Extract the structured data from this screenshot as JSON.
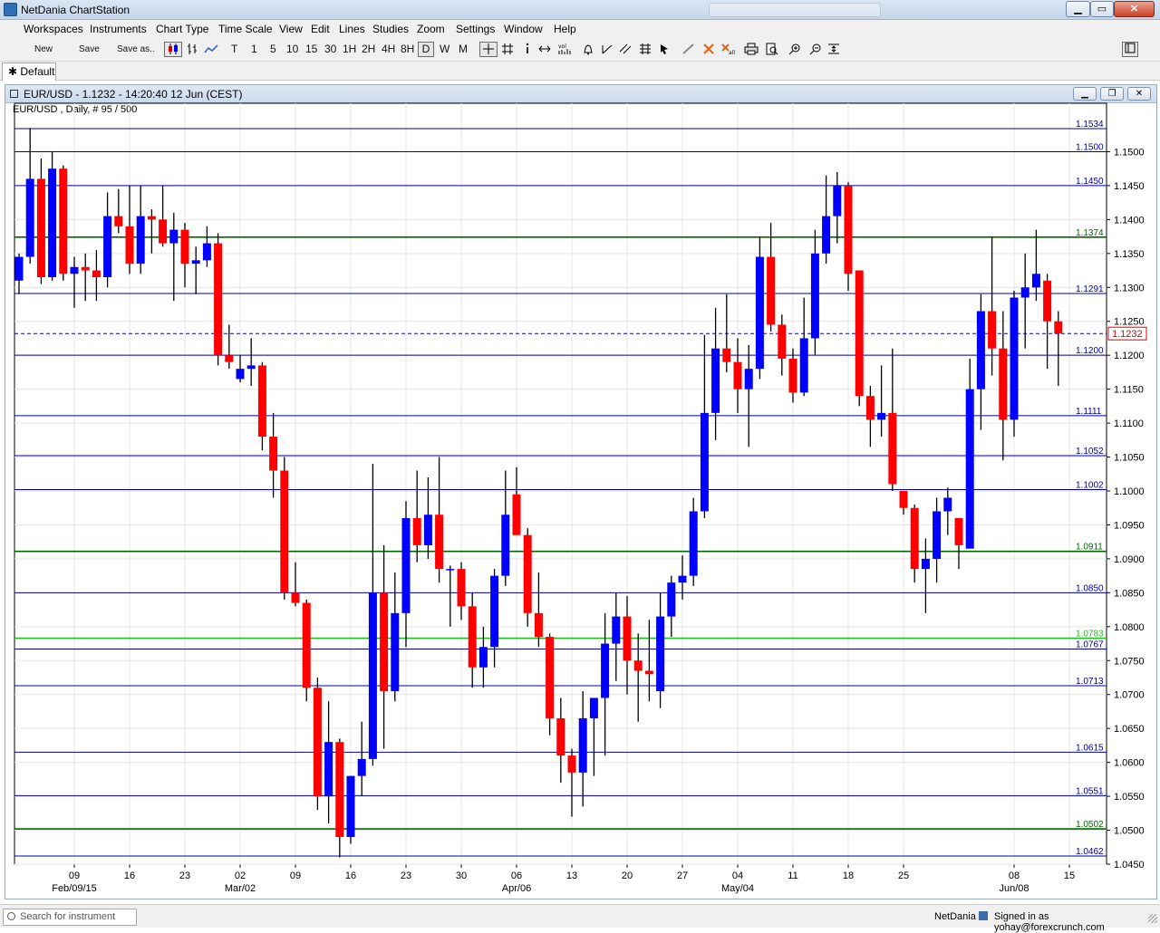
{
  "app": {
    "title": "NetDania ChartStation",
    "window_buttons": {
      "minimize": "▁",
      "maximize": "▭",
      "close": "✕"
    }
  },
  "menu": [
    "Workspaces",
    "Instruments",
    "Chart Type",
    "Time Scale",
    "View",
    "Edit",
    "Lines",
    "Studies",
    "Zoom",
    "Settings",
    "Window",
    "Help"
  ],
  "toolbar": {
    "new_label": "New",
    "save_label": "Save",
    "save_as_label": "Save as..",
    "timeframes": [
      "T",
      "1",
      "5",
      "10",
      "15",
      "30",
      "1H",
      "2H",
      "4H",
      "8H",
      "D",
      "W",
      "M"
    ],
    "selected_timeframe": "D",
    "icons": [
      "candlestick-icon",
      "ohlc-bars-icon",
      "line-chart-icon",
      "crosshair-icon",
      "grid-icon",
      "info-icon",
      "arrows-icon",
      "volume-icon",
      "bell-icon",
      "trendline-icon",
      "delete-icon",
      "print-icon",
      "zoom-in-icon",
      "zoom-out-icon",
      "fit-icon"
    ]
  },
  "tabs": {
    "active": "Default"
  },
  "chart_window": {
    "title": "EUR/USD - 1.1232 - 14:20:40  12 Jun (CEST)",
    "info": "EUR/USD , Daily, # 95 / 500"
  },
  "chart_data": {
    "type": "candlestick",
    "symbol": "EUR/USD",
    "timeframe": "Daily",
    "ylim": [
      1.045,
      1.155
    ],
    "yticks": [
      1.045,
      1.05,
      1.055,
      1.06,
      1.065,
      1.07,
      1.075,
      1.08,
      1.085,
      1.09,
      1.095,
      1.1,
      1.105,
      1.11,
      1.115,
      1.12,
      1.125,
      1.13,
      1.135,
      1.14,
      1.145,
      1.15
    ],
    "xticks": [
      {
        "label": "09",
        "sub": "Feb/09/15",
        "index": 5
      },
      {
        "label": "16",
        "index": 10
      },
      {
        "label": "23",
        "index": 15
      },
      {
        "label": "02",
        "sub": "Mar/02",
        "index": 20
      },
      {
        "label": "09",
        "index": 25
      },
      {
        "label": "16",
        "index": 30
      },
      {
        "label": "23",
        "index": 35
      },
      {
        "label": "30",
        "index": 40
      },
      {
        "label": "06",
        "sub": "Apr/06",
        "index": 45
      },
      {
        "label": "13",
        "index": 50
      },
      {
        "label": "20",
        "index": 55
      },
      {
        "label": "27",
        "index": 60
      },
      {
        "label": "04",
        "sub": "May/04",
        "index": 65
      },
      {
        "label": "11",
        "index": 70
      },
      {
        "label": "18",
        "index": 75
      },
      {
        "label": "25",
        "index": 80
      },
      {
        "label": "08",
        "sub": "Jun/08",
        "index": 90
      },
      {
        "label": "15",
        "index": 95
      }
    ],
    "current_price": "1.1232",
    "horizontal_lines": [
      {
        "value": 1.1534,
        "label": "1.1534",
        "color": "#0000aa"
      },
      {
        "value": 1.15,
        "label": "1.1500",
        "color": "#0000aa"
      },
      {
        "value": 1.145,
        "label": "1.1450",
        "color": "#0000aa"
      },
      {
        "value": 1.1374,
        "label": "1.1374",
        "color": "#006600"
      },
      {
        "value": 1.1291,
        "label": "1.1291",
        "color": "#0000aa"
      },
      {
        "value": 1.12,
        "label": "1.1200",
        "color": "#0000aa"
      },
      {
        "value": 1.1111,
        "label": "1.1111",
        "color": "#0000aa"
      },
      {
        "value": 1.1052,
        "label": "1.1052",
        "color": "#0000aa"
      },
      {
        "value": 1.1002,
        "label": "1.1002",
        "color": "#0000aa"
      },
      {
        "value": 1.0911,
        "label": "1.0911",
        "color": "#006600"
      },
      {
        "value": 1.085,
        "label": "1.0850",
        "color": "#0000aa"
      },
      {
        "value": 1.0783,
        "label": "1.0783",
        "color": "#22bb22"
      },
      {
        "value": 1.0767,
        "label": "1.0767",
        "color": "#0000aa"
      },
      {
        "value": 1.0713,
        "label": "1.0713",
        "color": "#0000aa"
      },
      {
        "value": 1.0615,
        "label": "1.0615",
        "color": "#0000aa"
      },
      {
        "value": 1.0551,
        "label": "1.0551",
        "color": "#0000aa"
      },
      {
        "value": 1.0502,
        "label": "1.0502",
        "color": "#006600"
      },
      {
        "value": 1.0462,
        "label": "1.0462",
        "color": "#0000aa"
      }
    ],
    "up_color": "#0000ff",
    "down_color": "#ff0000",
    "candles": [
      [
        1.131,
        1.135,
        1.129,
        1.1345
      ],
      [
        1.1345,
        1.1535,
        1.1335,
        1.146
      ],
      [
        1.146,
        1.149,
        1.1305,
        1.1315
      ],
      [
        1.1315,
        1.15,
        1.131,
        1.1475
      ],
      [
        1.1475,
        1.148,
        1.131,
        1.132
      ],
      [
        1.132,
        1.1345,
        1.127,
        1.133
      ],
      [
        1.133,
        1.135,
        1.128,
        1.1325
      ],
      [
        1.1325,
        1.1355,
        1.128,
        1.1315
      ],
      [
        1.1315,
        1.144,
        1.13,
        1.1405
      ],
      [
        1.1405,
        1.1445,
        1.138,
        1.139
      ],
      [
        1.139,
        1.145,
        1.132,
        1.1335
      ],
      [
        1.1335,
        1.145,
        1.132,
        1.1405
      ],
      [
        1.1405,
        1.1415,
        1.135,
        1.14
      ],
      [
        1.14,
        1.145,
        1.136,
        1.1365
      ],
      [
        1.1365,
        1.141,
        1.128,
        1.1385
      ],
      [
        1.1385,
        1.1395,
        1.13,
        1.1335
      ],
      [
        1.1335,
        1.136,
        1.129,
        1.134
      ],
      [
        1.134,
        1.139,
        1.133,
        1.1365
      ],
      [
        1.1365,
        1.138,
        1.1185,
        1.12
      ],
      [
        1.12,
        1.1245,
        1.118,
        1.119
      ],
      [
        1.1165,
        1.12,
        1.116,
        1.118
      ],
      [
        1.118,
        1.1225,
        1.1155,
        1.1185
      ],
      [
        1.1185,
        1.119,
        1.106,
        1.108
      ],
      [
        1.108,
        1.1115,
        1.099,
        1.103
      ],
      [
        1.103,
        1.105,
        1.084,
        1.085
      ],
      [
        1.085,
        1.0895,
        1.083,
        1.0835
      ],
      [
        1.0835,
        1.084,
        1.069,
        1.071
      ],
      [
        1.071,
        1.0725,
        1.053,
        1.055
      ],
      [
        1.055,
        1.069,
        1.051,
        1.063
      ],
      [
        1.063,
        1.0635,
        1.046,
        1.049
      ],
      [
        1.049,
        1.058,
        1.048,
        1.058
      ],
      [
        1.058,
        1.066,
        1.055,
        1.0605
      ],
      [
        1.0605,
        1.104,
        1.0595,
        1.085
      ],
      [
        1.085,
        1.092,
        1.062,
        1.0705
      ],
      [
        1.0705,
        1.088,
        1.069,
        1.082
      ],
      [
        1.082,
        1.0985,
        1.077,
        1.096
      ],
      [
        1.096,
        1.103,
        1.0895,
        1.092
      ],
      [
        1.092,
        1.102,
        1.09,
        1.0965
      ],
      [
        1.0965,
        1.105,
        1.0865,
        1.0885
      ],
      [
        1.0885,
        1.089,
        1.08,
        1.0885
      ],
      [
        1.0885,
        1.0895,
        1.081,
        1.083
      ],
      [
        1.083,
        1.085,
        1.071,
        1.074
      ],
      [
        1.074,
        1.08,
        1.071,
        1.077
      ],
      [
        1.077,
        1.0885,
        1.074,
        1.0875
      ],
      [
        1.0875,
        1.103,
        1.086,
        1.0965
      ],
      [
        1.0995,
        1.1035,
        1.0935,
        1.0935
      ],
      [
        1.0935,
        1.0945,
        1.08,
        1.082
      ],
      [
        1.082,
        1.088,
        1.077,
        1.0785
      ],
      [
        1.0785,
        1.079,
        1.064,
        1.0665
      ],
      [
        1.0665,
        1.0695,
        1.057,
        1.061
      ],
      [
        1.061,
        1.062,
        1.052,
        1.0585
      ],
      [
        1.0585,
        1.0705,
        1.0535,
        1.0665
      ],
      [
        1.0665,
        1.0695,
        1.058,
        1.0695
      ],
      [
        1.0695,
        1.082,
        1.061,
        1.0775
      ],
      [
        1.0775,
        1.085,
        1.072,
        1.0815
      ],
      [
        1.0815,
        1.0845,
        1.07,
        1.075
      ],
      [
        1.075,
        1.079,
        1.066,
        1.0735
      ],
      [
        1.0735,
        1.081,
        1.069,
        1.073
      ],
      [
        1.0705,
        1.085,
        1.068,
        1.0815
      ],
      [
        1.0815,
        1.0875,
        1.0785,
        1.0865
      ],
      [
        1.0865,
        1.0905,
        1.084,
        1.0875
      ],
      [
        1.0875,
        1.099,
        1.086,
        1.097
      ],
      [
        1.097,
        1.123,
        1.096,
        1.1115
      ],
      [
        1.1115,
        1.127,
        1.1075,
        1.121
      ],
      [
        1.121,
        1.129,
        1.1175,
        1.119
      ],
      [
        1.119,
        1.1225,
        1.1115,
        1.115
      ],
      [
        1.115,
        1.1215,
        1.1065,
        1.118
      ],
      [
        1.118,
        1.1375,
        1.1165,
        1.1345
      ],
      [
        1.1345,
        1.1395,
        1.1235,
        1.1245
      ],
      [
        1.1245,
        1.126,
        1.117,
        1.1195
      ],
      [
        1.1195,
        1.121,
        1.113,
        1.1145
      ],
      [
        1.1145,
        1.1285,
        1.114,
        1.1225
      ],
      [
        1.1225,
        1.1385,
        1.12,
        1.135
      ],
      [
        1.135,
        1.1465,
        1.1335,
        1.1405
      ],
      [
        1.1405,
        1.147,
        1.1365,
        1.145
      ],
      [
        1.145,
        1.1455,
        1.1295,
        1.132
      ],
      [
        1.1325,
        1.1325,
        1.1125,
        1.114
      ],
      [
        1.114,
        1.1155,
        1.1065,
        1.1105
      ],
      [
        1.1105,
        1.1185,
        1.108,
        1.1115
      ],
      [
        1.1115,
        1.121,
        1.1,
        1.101
      ],
      [
        1.1,
        1.1,
        1.0965,
        1.0975
      ],
      [
        1.0975,
        1.098,
        1.0865,
        1.0885
      ],
      [
        1.0885,
        1.093,
        1.082,
        1.09
      ],
      [
        1.09,
        1.099,
        1.0865,
        1.097
      ],
      [
        1.097,
        1.1005,
        1.0935,
        1.099
      ],
      [
        1.096,
        1.096,
        1.0885,
        1.092
      ],
      [
        1.0915,
        1.1195,
        1.0915,
        1.115
      ],
      [
        1.115,
        1.129,
        1.109,
        1.1265
      ],
      [
        1.1265,
        1.1375,
        1.117,
        1.121
      ],
      [
        1.121,
        1.1265,
        1.1045,
        1.1105
      ],
      [
        1.1105,
        1.1295,
        1.108,
        1.1285
      ],
      [
        1.1285,
        1.135,
        1.121,
        1.13
      ],
      [
        1.13,
        1.1385,
        1.128,
        1.132
      ],
      [
        1.131,
        1.132,
        1.118,
        1.125
      ],
      [
        1.125,
        1.1265,
        1.1155,
        1.1232
      ]
    ]
  },
  "status": {
    "search_placeholder": "Search for instrument",
    "brand": "NetDania",
    "signed_in": "Signed in as yohay@forexcrunch.com"
  }
}
